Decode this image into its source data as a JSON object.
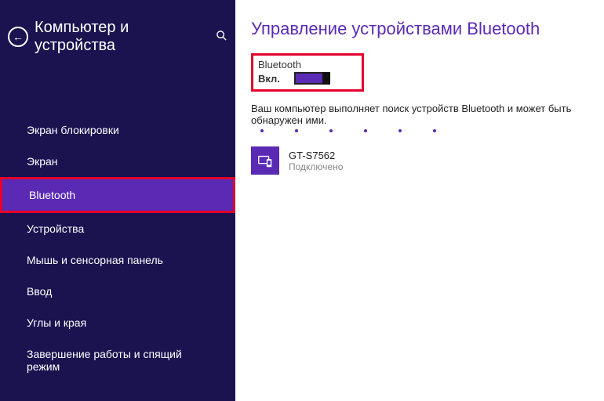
{
  "sidebar": {
    "title": "Компьютер и устройства",
    "items": [
      {
        "label": "Экран блокировки"
      },
      {
        "label": "Экран"
      },
      {
        "label": "Bluetooth"
      },
      {
        "label": "Устройства"
      },
      {
        "label": "Мышь и сенсорная панель"
      },
      {
        "label": "Ввод"
      },
      {
        "label": "Углы и края"
      },
      {
        "label": "Завершение работы и спящий режим"
      }
    ],
    "selected_index": 2
  },
  "main": {
    "title": "Управление устройствами Bluetooth",
    "toggle": {
      "label": "Bluetooth",
      "state": "Вкл.",
      "on": true
    },
    "status_text": "Ваш компьютер выполняет поиск устройств Bluetooth и может быть обнаружен ими.",
    "devices": [
      {
        "name": "GT-S7562",
        "status": "Подключено"
      }
    ]
  },
  "colors": {
    "accent": "#5a2ab5",
    "sidebar_bg": "#1a1350",
    "highlight": "#e3002b"
  }
}
